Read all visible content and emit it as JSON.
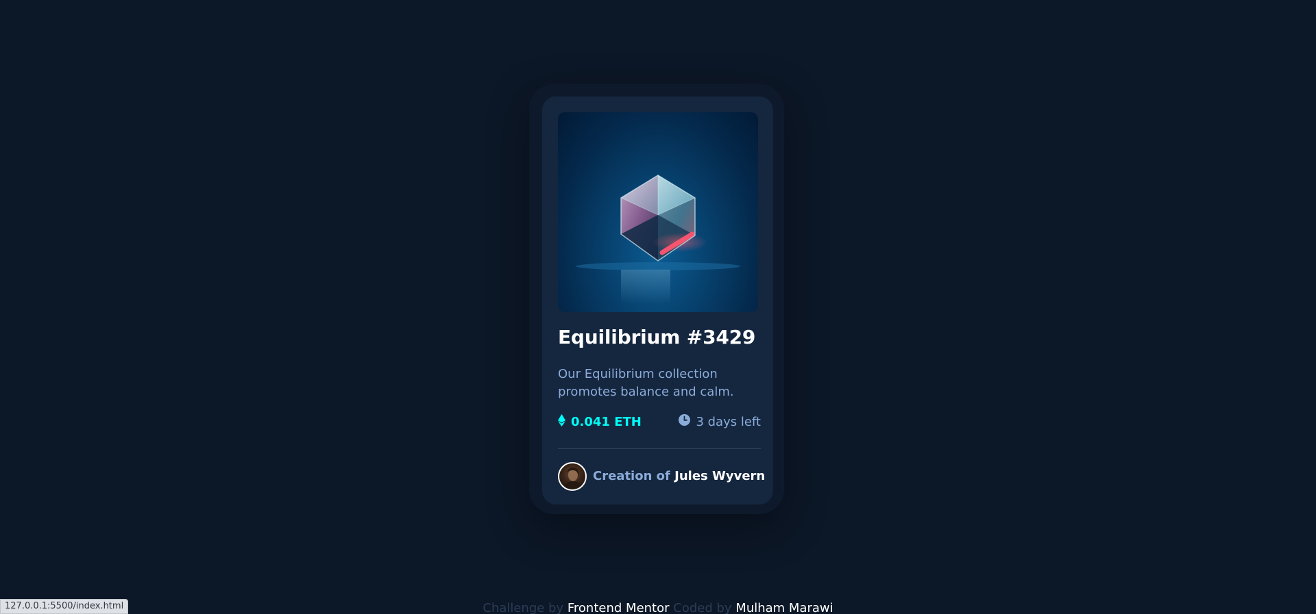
{
  "card": {
    "title": "Equilibrium #3429",
    "description": "Our Equilibrium collection promotes balance and calm.",
    "price": "0.041 ETH",
    "time_left": "3 days left",
    "creator_prefix": "Creation of",
    "creator_name": "Jules Wyvern"
  },
  "footer": {
    "challenge_prefix": "Challenge by",
    "challenge_link": "Frontend Mentor",
    "coded_prefix": "Coded by",
    "coded_link": "Mulham Marawi"
  },
  "status_bar": {
    "url": "127.0.0.1:5500/index.html"
  },
  "icons": {
    "price_icon": "ethereum-icon",
    "time_icon": "clock-icon"
  },
  "colors": {
    "page_background": "#0c1727",
    "card_background": "#15263f",
    "accent_cyan": "#00fff8",
    "soft_blue": "#8bacd9",
    "white": "#ffffff"
  }
}
